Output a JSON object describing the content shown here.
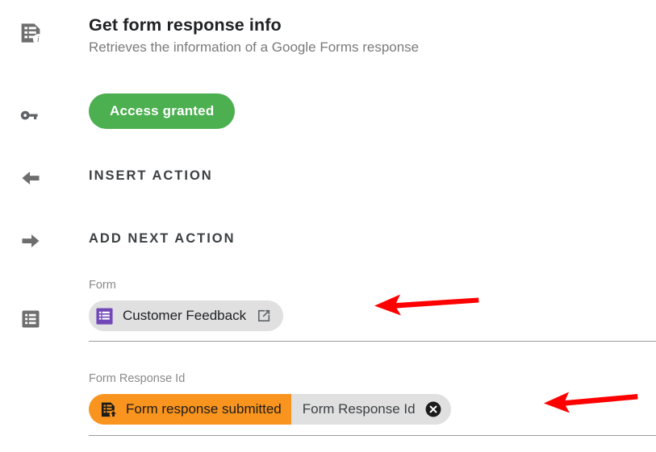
{
  "header": {
    "icon": "form-info-icon",
    "title": "Get form response info",
    "subtitle": "Retrieves the information of a Google Forms response"
  },
  "access": {
    "icon": "key-icon",
    "button_label": "Access granted",
    "color": "#4CAF50"
  },
  "actions": [
    {
      "icon": "arrow-left-icon",
      "label": "INSERT ACTION"
    },
    {
      "icon": "arrow-right-icon",
      "label": "ADD NEXT ACTION"
    }
  ],
  "fields": [
    {
      "rail_icon": "form-list-icon",
      "label": "Form",
      "chip": {
        "icon": "google-forms-icon",
        "icon_color": "#7248B9",
        "text": "Customer Feedback",
        "action_icon": "open-in-new-icon"
      }
    },
    {
      "label": "Form Response Id",
      "chip_combo": {
        "trigger_icon": "form-submitted-icon",
        "trigger_text": "Form response submitted",
        "trigger_color": "#F9941E",
        "value_text": "Form Response Id",
        "value_color": "#E0E0E0",
        "remove_icon": "close-circle-icon"
      }
    }
  ],
  "annotations": {
    "color": "#FF0000",
    "arrows": [
      {
        "name": "arrow-pointing-to-form-chip",
        "direction": "left"
      },
      {
        "name": "arrow-pointing-to-response-id-chip",
        "direction": "left"
      }
    ]
  }
}
